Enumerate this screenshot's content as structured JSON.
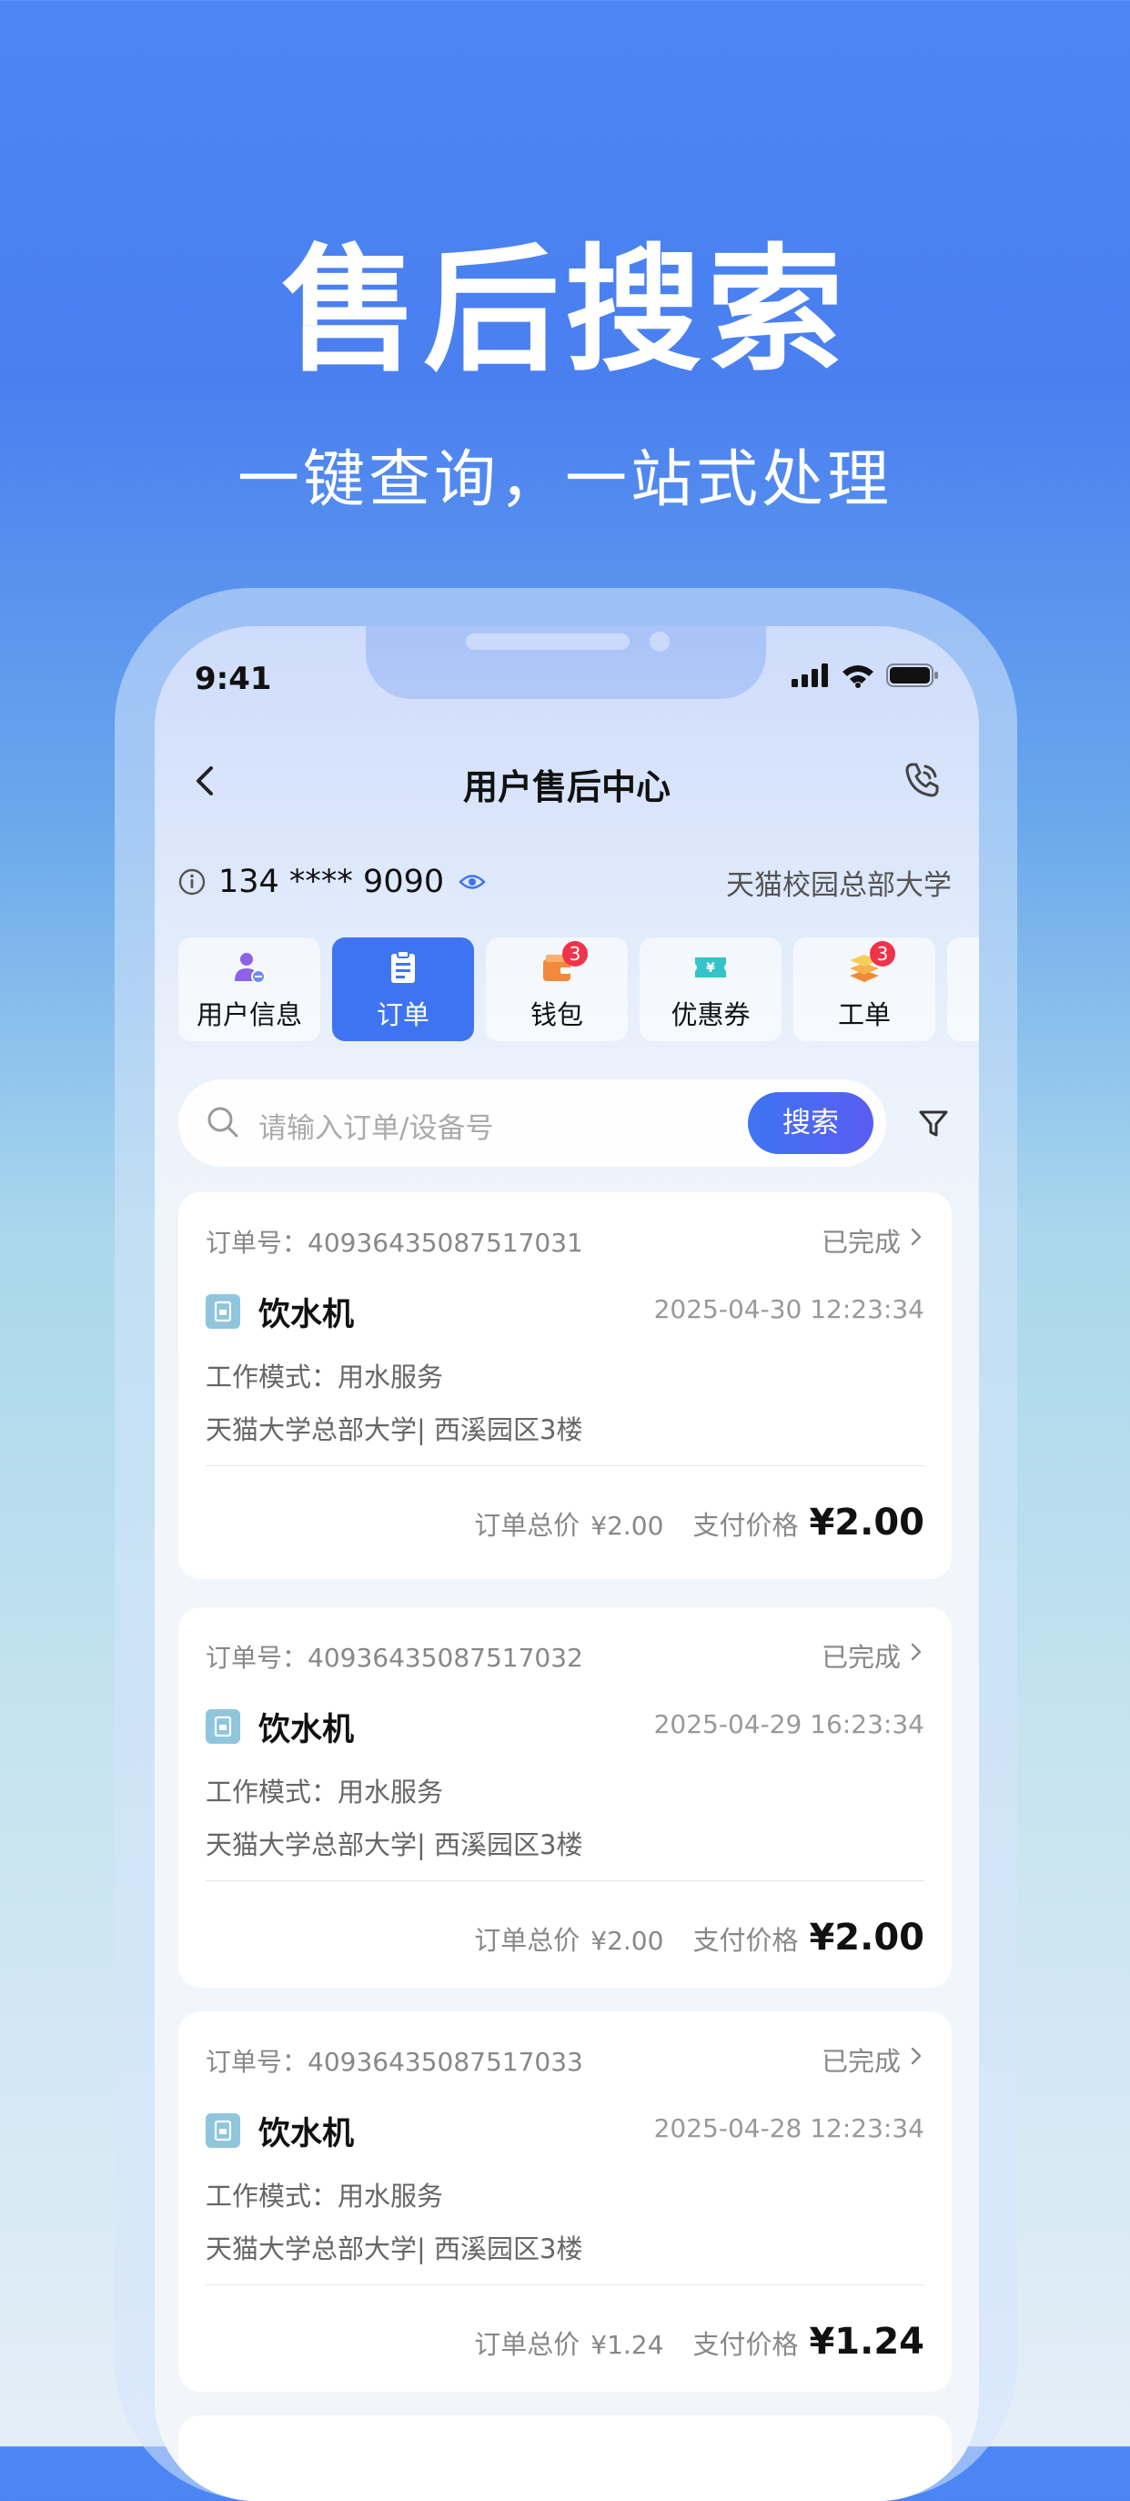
{
  "hero": {
    "title": "售后搜索",
    "subtitle": "一键查询，一站式处理"
  },
  "status_bar": {
    "time": "9:41"
  },
  "nav": {
    "title": "用户售后中心"
  },
  "user": {
    "phone": "134 **** 9090",
    "campus": "天猫校园总部大学"
  },
  "tabs": [
    {
      "label": "用户信息",
      "icon": "user-icon",
      "active": false,
      "badge": ""
    },
    {
      "label": "订单",
      "icon": "clipboard-icon",
      "active": true,
      "badge": ""
    },
    {
      "label": "钱包",
      "icon": "wallet-icon",
      "active": false,
      "badge": "3"
    },
    {
      "label": "优惠券",
      "icon": "coupon-icon",
      "active": false,
      "badge": ""
    },
    {
      "label": "工单",
      "icon": "stack-icon",
      "active": false,
      "badge": "3"
    }
  ],
  "search": {
    "placeholder": "请输入订单/设备号",
    "button_label": "搜索"
  },
  "orders": [
    {
      "id_label": "订单号：40936435087517031",
      "status": "已完成",
      "device": "饮水机",
      "time": "2025-04-30 12:23:34",
      "mode": "工作模式：用水服务",
      "address": "天猫大学总部大学| 西溪园区3楼",
      "total_label": "订单总价",
      "total": "¥2.00",
      "pay_label": "支付价格",
      "pay": "¥2.00"
    },
    {
      "id_label": "订单号：40936435087517032",
      "status": "已完成",
      "device": "饮水机",
      "time": "2025-04-29 16:23:34",
      "mode": "工作模式：用水服务",
      "address": "天猫大学总部大学| 西溪园区3楼",
      "total_label": "订单总价",
      "total": "¥2.00",
      "pay_label": "支付价格",
      "pay": "¥2.00"
    },
    {
      "id_label": "订单号：40936435087517033",
      "status": "已完成",
      "device": "饮水机",
      "time": "2025-04-28 12:23:34",
      "mode": "工作模式：用水服务",
      "address": "天猫大学总部大学| 西溪园区3楼",
      "total_label": "订单总价",
      "total": "¥1.24",
      "pay_label": "支付价格",
      "pay": "¥1.24"
    }
  ],
  "colors": {
    "accent": "#3e74f2",
    "badge": "#f0334b",
    "device_icon": "#8fc6de"
  }
}
